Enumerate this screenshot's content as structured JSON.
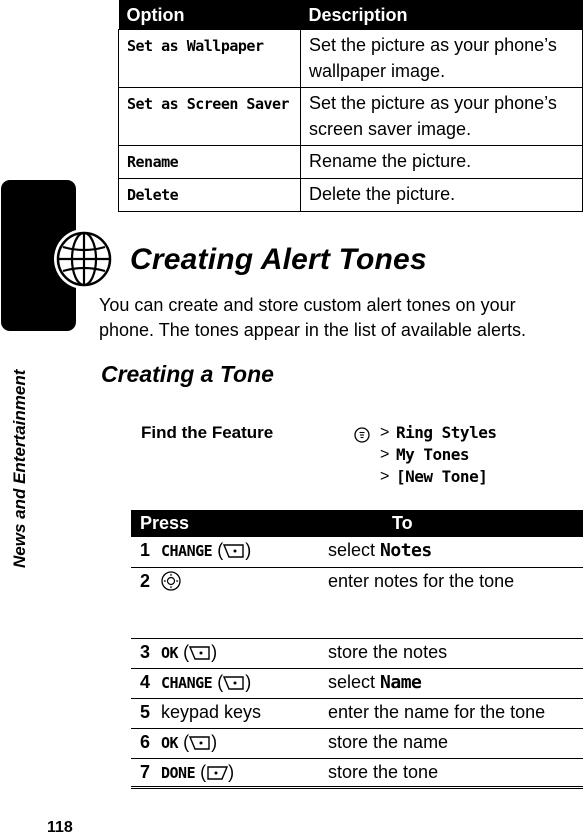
{
  "options_table": {
    "headers": [
      "Option",
      "Description"
    ],
    "rows": [
      {
        "option": "Set as Wallpaper",
        "description": "Set the picture as your phone’s wallpaper image."
      },
      {
        "option": "Set as Screen Saver",
        "description": "Set the picture as your phone’s screen saver image."
      },
      {
        "option": "Rename",
        "description": "Rename the picture."
      },
      {
        "option": "Delete",
        "description": "Delete the picture."
      }
    ]
  },
  "side_tab": {
    "icon": "globe-icon",
    "label": "News and Entertainment"
  },
  "section": {
    "title": "Creating Alert Tones",
    "intro": "You can create and store custom alert tones on your phone. The tones appear in the list of available alerts.",
    "subtitle": "Creating a Tone"
  },
  "find_feature": {
    "label": "Find the Feature",
    "menu_icon": "menu-key-icon",
    "separator": ">",
    "path": [
      "Ring Styles",
      "My Tones",
      "[New Tone]"
    ]
  },
  "steps_table": {
    "headers": [
      "Press",
      "To"
    ],
    "rows": [
      {
        "num": "1",
        "key": "CHANGE",
        "key_icon": "left-softkey-icon",
        "action": "select ",
        "action_mono": "Notes"
      },
      {
        "num": "2",
        "key": "",
        "key_icon": "nav-key-icon",
        "action": "enter notes for the tone",
        "action_mono": ""
      },
      {
        "num": "3",
        "key": "OK",
        "key_icon": "left-softkey-icon",
        "action": "store the notes",
        "action_mono": ""
      },
      {
        "num": "4",
        "key": "CHANGE",
        "key_icon": "left-softkey-icon",
        "action": "select ",
        "action_mono": "Name"
      },
      {
        "num": "5",
        "key_plain": "keypad keys",
        "action": "enter the name for the tone",
        "action_mono": ""
      },
      {
        "num": "6",
        "key": "OK",
        "key_icon": "left-softkey-icon",
        "action": "store the name",
        "action_mono": ""
      },
      {
        "num": "7",
        "key": "DONE",
        "key_icon": "right-softkey-icon",
        "action": "store the tone",
        "action_mono": ""
      }
    ]
  },
  "page_number": "118"
}
